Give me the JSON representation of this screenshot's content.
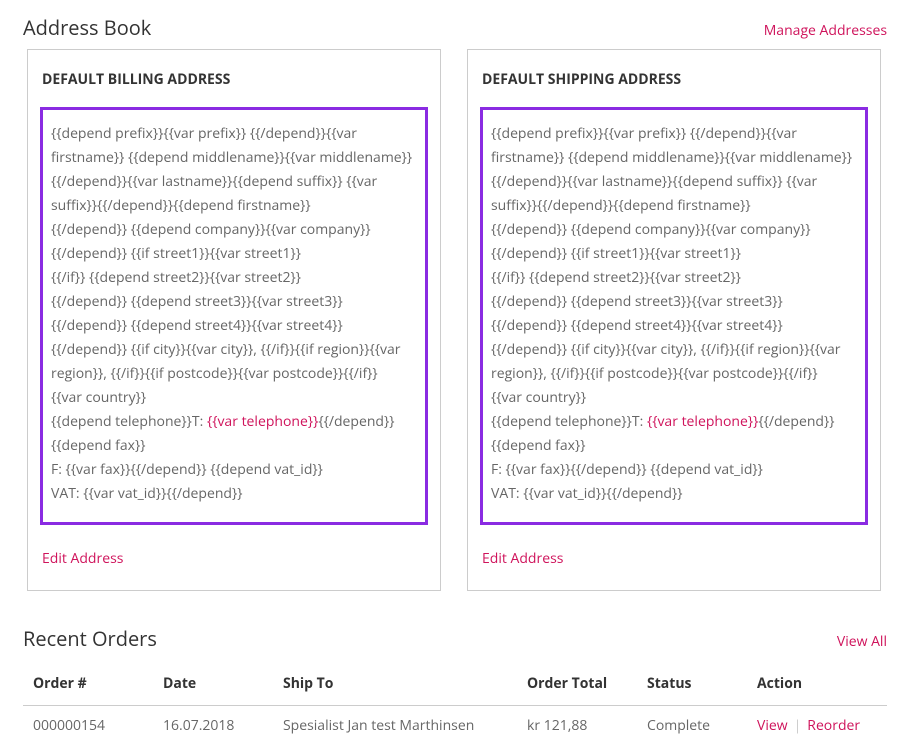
{
  "addressBook": {
    "title": "Address Book",
    "manageLink": "Manage Addresses",
    "billing": {
      "heading": "DEFAULT BILLING ADDRESS",
      "line1": "{{depend prefix}}{{var prefix}} {{/depend}}{{var firstname}} {{depend middlename}}{{var middlename}} {{/depend}}{{var lastname}}{{depend suffix}} {{var suffix}}{{/depend}}{{depend firstname}}",
      "line2": "{{/depend}} {{depend company}}{{var company}}",
      "line3": "{{/depend}} {{if street1}}{{var street1}}",
      "line4": "{{/if}} {{depend street2}}{{var street2}}",
      "line5": "{{/depend}} {{depend street3}}{{var street3}}",
      "line6": "{{/depend}} {{depend street4}}{{var street4}}",
      "line7": "{{/depend}} {{if city}}{{var city}}, {{/if}}{{if region}}{{var region}}, {{/if}}{{if postcode}}{{var postcode}}{{/if}}",
      "line8": "{{var country}}",
      "line9_pre": "{{depend telephone}}T: ",
      "line9_tel": "{{var telephone}}",
      "line9_post": "{{/depend}} {{depend fax}}",
      "line10": "F: {{var fax}}{{/depend}} {{depend vat_id}}",
      "line11": "VAT: {{var vat_id}}{{/depend}}",
      "editLink": "Edit Address"
    },
    "shipping": {
      "heading": "DEFAULT SHIPPING ADDRESS",
      "line1": "{{depend prefix}}{{var prefix}} {{/depend}}{{var firstname}} {{depend middlename}}{{var middlename}} {{/depend}}{{var lastname}}{{depend suffix}} {{var suffix}}{{/depend}}{{depend firstname}}",
      "line2": "{{/depend}} {{depend company}}{{var company}}",
      "line3": "{{/depend}} {{if street1}}{{var street1}}",
      "line4": "{{/if}} {{depend street2}}{{var street2}}",
      "line5": "{{/depend}} {{depend street3}}{{var street3}}",
      "line6": "{{/depend}} {{depend street4}}{{var street4}}",
      "line7": "{{/depend}} {{if city}}{{var city}}, {{/if}}{{if region}}{{var region}}, {{/if}}{{if postcode}}{{var postcode}}{{/if}}",
      "line8": "{{var country}}",
      "line9_pre": "{{depend telephone}}T: ",
      "line9_tel": "{{var telephone}}",
      "line9_post": "{{/depend}} {{depend fax}}",
      "line10": "F: {{var fax}}{{/depend}} {{depend vat_id}}",
      "line11": "VAT: {{var vat_id}}{{/depend}}",
      "editLink": "Edit Address"
    }
  },
  "recentOrders": {
    "title": "Recent Orders",
    "viewAll": "View All",
    "columns": {
      "orderNo": "Order #",
      "date": "Date",
      "shipTo": "Ship To",
      "total": "Order Total",
      "status": "Status",
      "action": "Action"
    },
    "row": {
      "orderNo": "000000154",
      "date": "16.07.2018",
      "shipTo": "Spesialist Jan test Marthinsen",
      "total": "kr 121,88",
      "status": "Complete",
      "viewLabel": "View",
      "reorderLabel": "Reorder"
    }
  }
}
